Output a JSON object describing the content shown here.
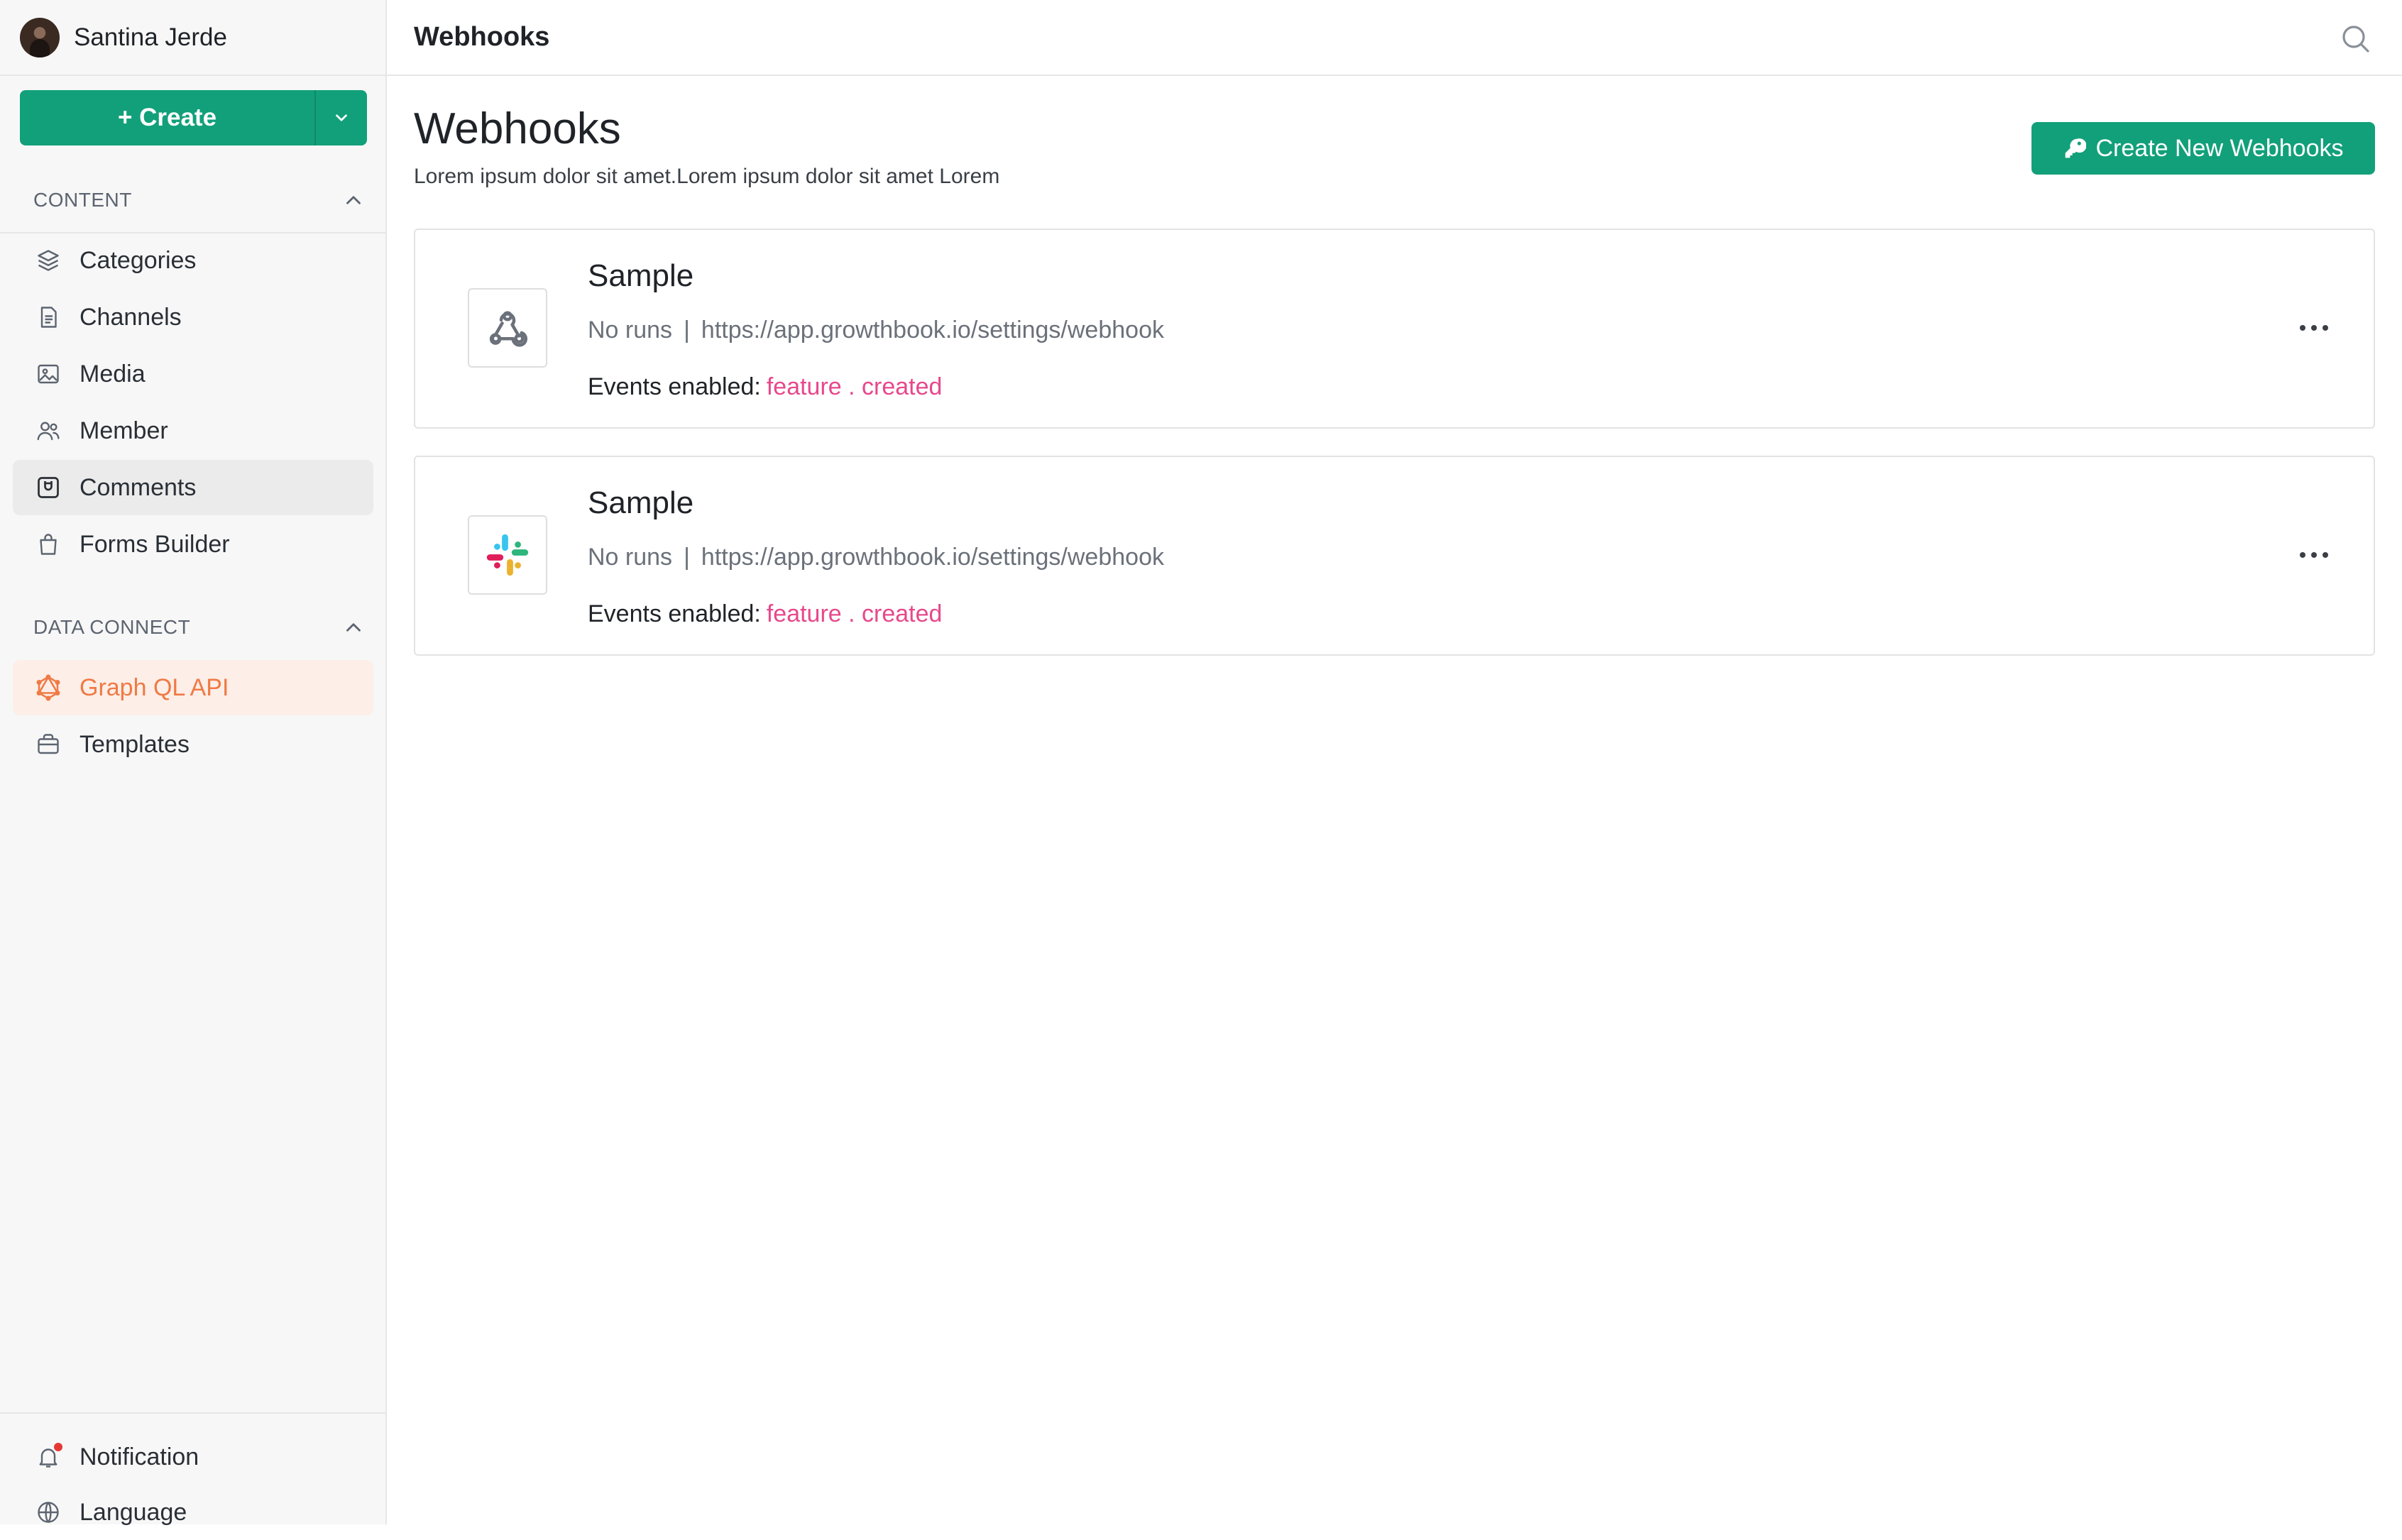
{
  "user": {
    "name": "Santina Jerde"
  },
  "create": {
    "label": "+ Create"
  },
  "sidebar": {
    "content_heading": "CONTENT",
    "content_items": [
      {
        "label": "Categories",
        "icon": "layers-icon"
      },
      {
        "label": "Channels",
        "icon": "document-icon"
      },
      {
        "label": "Media",
        "icon": "image-icon"
      },
      {
        "label": "Member",
        "icon": "users-icon"
      },
      {
        "label": "Comments",
        "icon": "comment-box-icon"
      },
      {
        "label": "Forms Builder",
        "icon": "bag-icon"
      }
    ],
    "data_heading": "DATA CONNECT",
    "data_items": [
      {
        "label": "Graph QL API",
        "icon": "graphql-icon"
      },
      {
        "label": "Templates",
        "icon": "template-icon"
      }
    ],
    "bottom_items": [
      {
        "label": "Notification",
        "icon": "bell-icon"
      },
      {
        "label": "Language",
        "icon": "globe-icon"
      }
    ]
  },
  "header": {
    "title": "Webhooks"
  },
  "main": {
    "title": "Webhooks",
    "subtitle": "Lorem ipsum dolor sit amet.Lorem ipsum dolor sit amet Lorem",
    "new_button": "Create New Webhooks",
    "webhooks": [
      {
        "name": "Sample",
        "runs": "No runs",
        "separator": "|",
        "url": "https://app.growthbook.io/settings/webhook",
        "events_label": "Events enabled:",
        "events_value": "feature . created",
        "logo": "webhook-icon"
      },
      {
        "name": "Sample",
        "runs": "No runs",
        "separator": "|",
        "url": "https://app.growthbook.io/settings/webhook",
        "events_label": "Events enabled:",
        "events_value": "feature . created",
        "logo": "slack-icon"
      }
    ]
  },
  "colors": {
    "accent": "#12a07a",
    "active_orange": "#ef7a45",
    "event_pink": "#e7488c",
    "notification_dot": "#e53935"
  }
}
